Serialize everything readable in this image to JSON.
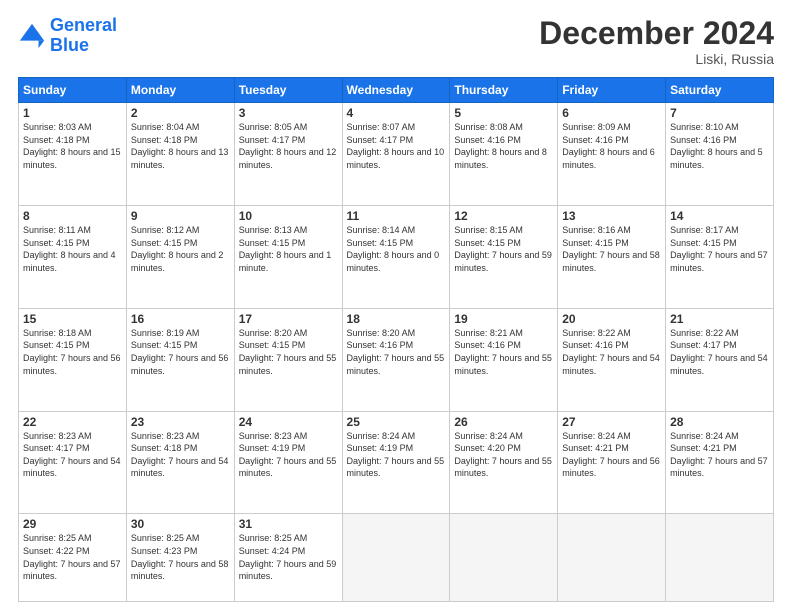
{
  "header": {
    "logo_line1": "General",
    "logo_line2": "Blue",
    "title": "December 2024",
    "subtitle": "Liski, Russia"
  },
  "weekdays": [
    "Sunday",
    "Monday",
    "Tuesday",
    "Wednesday",
    "Thursday",
    "Friday",
    "Saturday"
  ],
  "weeks": [
    [
      {
        "day": "1",
        "sunrise": "8:03 AM",
        "sunset": "4:18 PM",
        "daylight": "8 hours and 15 minutes."
      },
      {
        "day": "2",
        "sunrise": "8:04 AM",
        "sunset": "4:18 PM",
        "daylight": "8 hours and 13 minutes."
      },
      {
        "day": "3",
        "sunrise": "8:05 AM",
        "sunset": "4:17 PM",
        "daylight": "8 hours and 12 minutes."
      },
      {
        "day": "4",
        "sunrise": "8:07 AM",
        "sunset": "4:17 PM",
        "daylight": "8 hours and 10 minutes."
      },
      {
        "day": "5",
        "sunrise": "8:08 AM",
        "sunset": "4:16 PM",
        "daylight": "8 hours and 8 minutes."
      },
      {
        "day": "6",
        "sunrise": "8:09 AM",
        "sunset": "4:16 PM",
        "daylight": "8 hours and 6 minutes."
      },
      {
        "day": "7",
        "sunrise": "8:10 AM",
        "sunset": "4:16 PM",
        "daylight": "8 hours and 5 minutes."
      }
    ],
    [
      {
        "day": "8",
        "sunrise": "8:11 AM",
        "sunset": "4:15 PM",
        "daylight": "8 hours and 4 minutes."
      },
      {
        "day": "9",
        "sunrise": "8:12 AM",
        "sunset": "4:15 PM",
        "daylight": "8 hours and 2 minutes."
      },
      {
        "day": "10",
        "sunrise": "8:13 AM",
        "sunset": "4:15 PM",
        "daylight": "8 hours and 1 minute."
      },
      {
        "day": "11",
        "sunrise": "8:14 AM",
        "sunset": "4:15 PM",
        "daylight": "8 hours and 0 minutes."
      },
      {
        "day": "12",
        "sunrise": "8:15 AM",
        "sunset": "4:15 PM",
        "daylight": "7 hours and 59 minutes."
      },
      {
        "day": "13",
        "sunrise": "8:16 AM",
        "sunset": "4:15 PM",
        "daylight": "7 hours and 58 minutes."
      },
      {
        "day": "14",
        "sunrise": "8:17 AM",
        "sunset": "4:15 PM",
        "daylight": "7 hours and 57 minutes."
      }
    ],
    [
      {
        "day": "15",
        "sunrise": "8:18 AM",
        "sunset": "4:15 PM",
        "daylight": "7 hours and 56 minutes."
      },
      {
        "day": "16",
        "sunrise": "8:19 AM",
        "sunset": "4:15 PM",
        "daylight": "7 hours and 56 minutes."
      },
      {
        "day": "17",
        "sunrise": "8:20 AM",
        "sunset": "4:15 PM",
        "daylight": "7 hours and 55 minutes."
      },
      {
        "day": "18",
        "sunrise": "8:20 AM",
        "sunset": "4:16 PM",
        "daylight": "7 hours and 55 minutes."
      },
      {
        "day": "19",
        "sunrise": "8:21 AM",
        "sunset": "4:16 PM",
        "daylight": "7 hours and 55 minutes."
      },
      {
        "day": "20",
        "sunrise": "8:22 AM",
        "sunset": "4:16 PM",
        "daylight": "7 hours and 54 minutes."
      },
      {
        "day": "21",
        "sunrise": "8:22 AM",
        "sunset": "4:17 PM",
        "daylight": "7 hours and 54 minutes."
      }
    ],
    [
      {
        "day": "22",
        "sunrise": "8:23 AM",
        "sunset": "4:17 PM",
        "daylight": "7 hours and 54 minutes."
      },
      {
        "day": "23",
        "sunrise": "8:23 AM",
        "sunset": "4:18 PM",
        "daylight": "7 hours and 54 minutes."
      },
      {
        "day": "24",
        "sunrise": "8:23 AM",
        "sunset": "4:19 PM",
        "daylight": "7 hours and 55 minutes."
      },
      {
        "day": "25",
        "sunrise": "8:24 AM",
        "sunset": "4:19 PM",
        "daylight": "7 hours and 55 minutes."
      },
      {
        "day": "26",
        "sunrise": "8:24 AM",
        "sunset": "4:20 PM",
        "daylight": "7 hours and 55 minutes."
      },
      {
        "day": "27",
        "sunrise": "8:24 AM",
        "sunset": "4:21 PM",
        "daylight": "7 hours and 56 minutes."
      },
      {
        "day": "28",
        "sunrise": "8:24 AM",
        "sunset": "4:21 PM",
        "daylight": "7 hours and 57 minutes."
      }
    ],
    [
      {
        "day": "29",
        "sunrise": "8:25 AM",
        "sunset": "4:22 PM",
        "daylight": "7 hours and 57 minutes."
      },
      {
        "day": "30",
        "sunrise": "8:25 AM",
        "sunset": "4:23 PM",
        "daylight": "7 hours and 58 minutes."
      },
      {
        "day": "31",
        "sunrise": "8:25 AM",
        "sunset": "4:24 PM",
        "daylight": "7 hours and 59 minutes."
      },
      null,
      null,
      null,
      null
    ]
  ]
}
